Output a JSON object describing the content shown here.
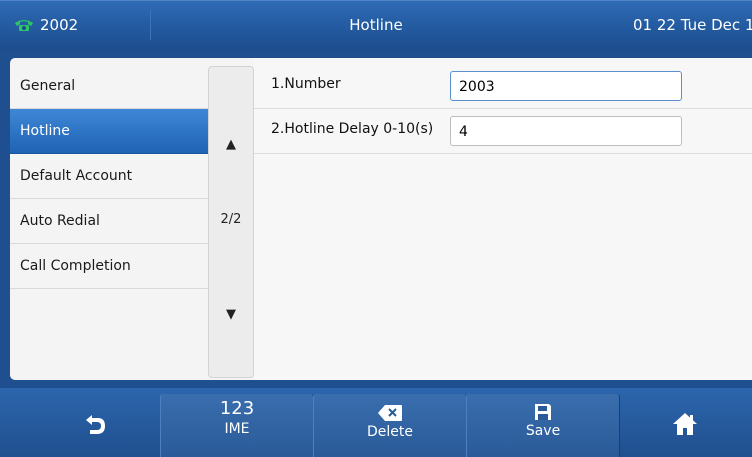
{
  "status_bar": {
    "extension": "2002",
    "title": "Hotline",
    "datetime": "01 22 Tue Dec 17"
  },
  "menu": {
    "items": [
      {
        "label": "General",
        "active": false
      },
      {
        "label": "Hotline",
        "active": true
      },
      {
        "label": "Default Account",
        "active": false
      },
      {
        "label": "Auto Redial",
        "active": false
      },
      {
        "label": "Call Completion",
        "active": false
      }
    ]
  },
  "pager": {
    "up_icon": "▲",
    "page": "2/2",
    "down_icon": "▼"
  },
  "form": {
    "fields": [
      {
        "label": "1.Number",
        "value": "2003"
      },
      {
        "label": "2.Hotline Delay 0-10(s)",
        "value": "4"
      }
    ]
  },
  "softkeys": {
    "back_icon": "back-arrow-icon",
    "ime_mode": "123",
    "ime_label": "IME",
    "delete_label": "Delete",
    "save_label": "Save",
    "home_icon": "home-icon"
  },
  "colors": {
    "accent": "#2566b5",
    "active_item": "#2f74c4",
    "panel_bg": "#f4f4f4"
  }
}
